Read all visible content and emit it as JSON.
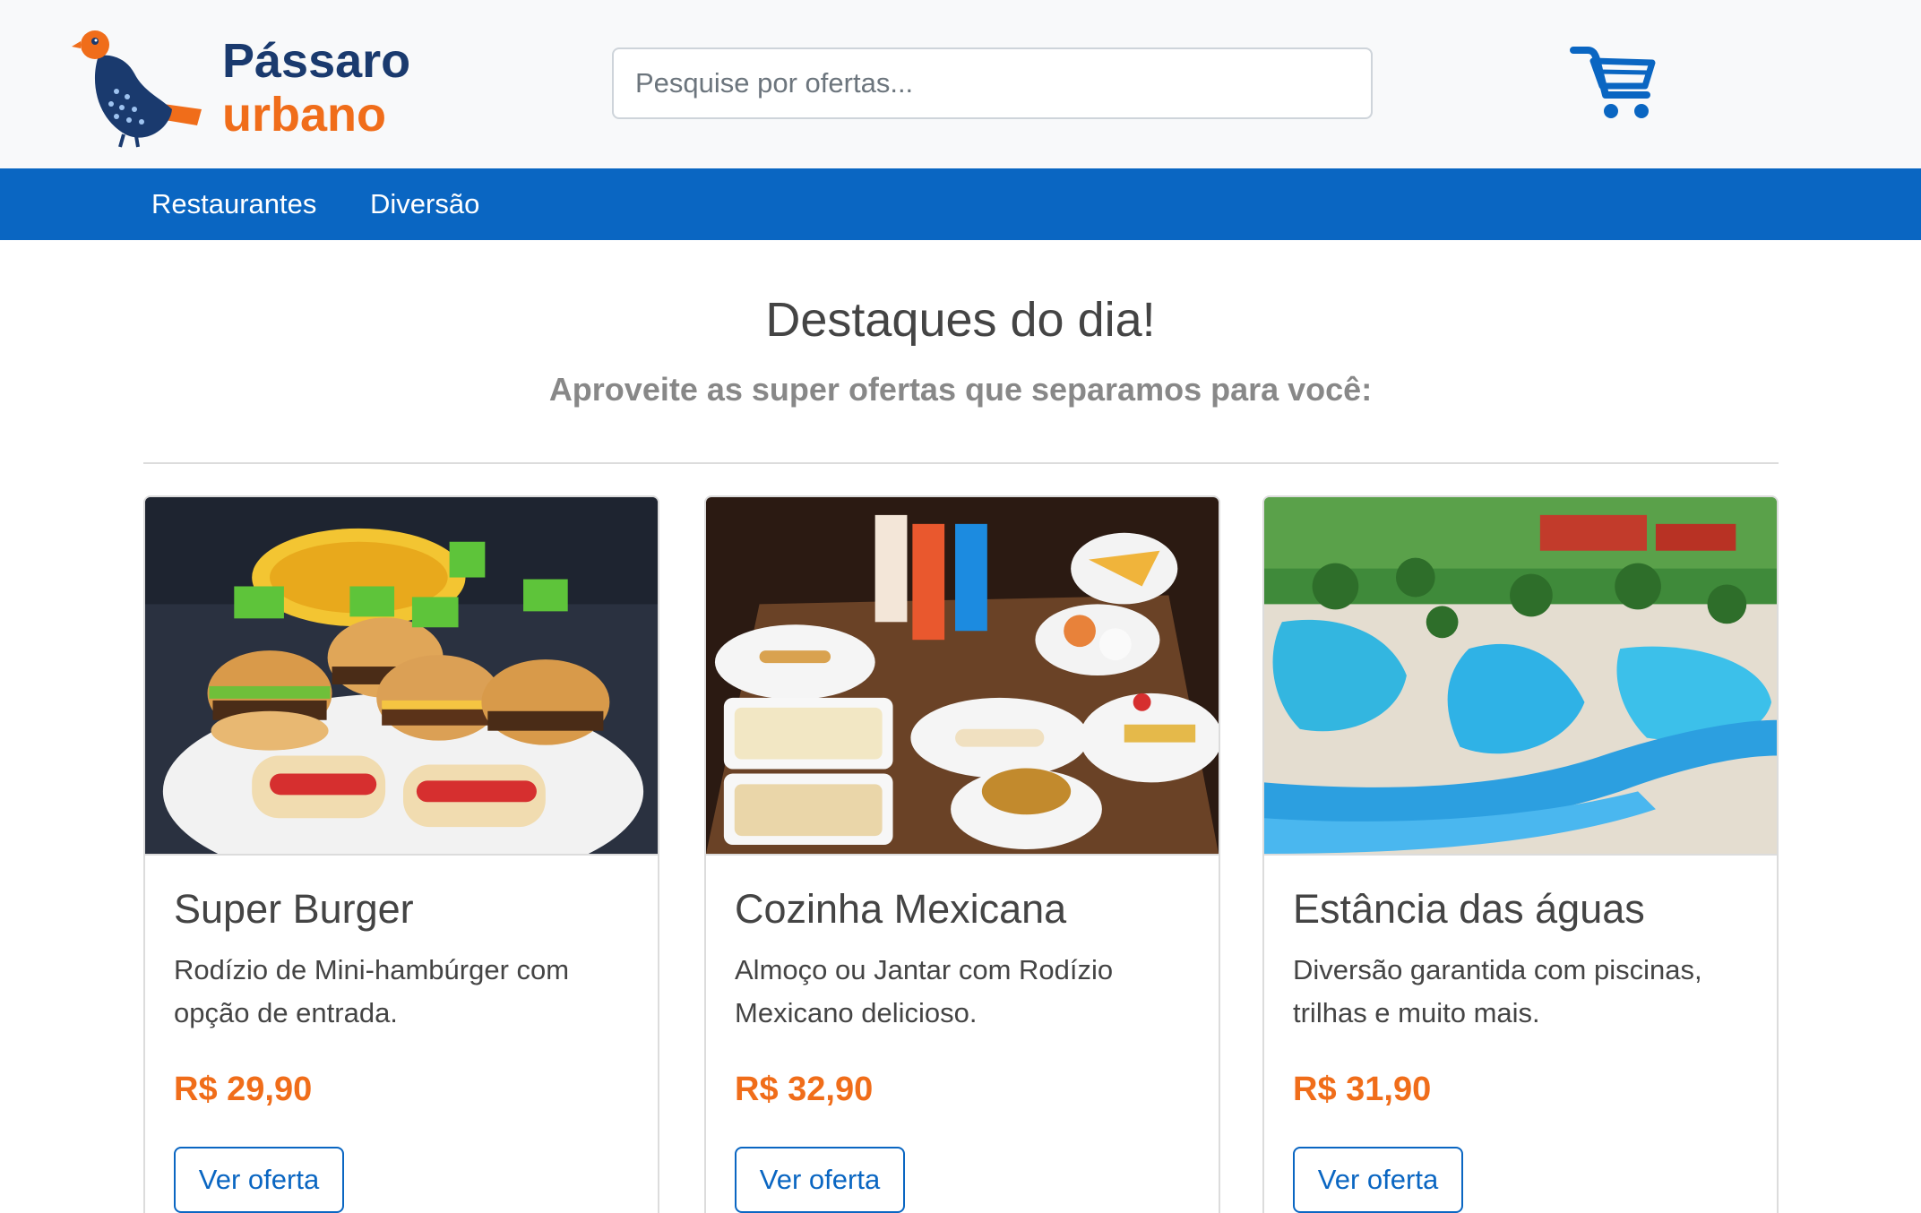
{
  "brand": {
    "line1": "Pássaro",
    "line2": "urbano"
  },
  "search": {
    "placeholder": "Pesquise por ofertas..."
  },
  "nav": [
    {
      "label": "Restaurantes"
    },
    {
      "label": "Diversão"
    }
  ],
  "hero": {
    "title": "Destaques do dia!",
    "subtitle": "Aproveite as super ofertas que separamos para você:"
  },
  "offers": [
    {
      "title": "Super Burger",
      "description": "Rodízio de Mini-hambúrger com opção de entrada.",
      "price": "R$ 29,90",
      "button": "Ver oferta",
      "image_icon": "burger-photo"
    },
    {
      "title": "Cozinha Mexicana",
      "description": "Almoço ou Jantar com Rodízio Mexicano delicioso.",
      "price": "R$ 32,90",
      "button": "Ver oferta",
      "image_icon": "mexican-food-photo"
    },
    {
      "title": "Estância das águas",
      "description": "Diversão garantida com piscinas, trilhas e muito mais.",
      "price": "R$ 31,90",
      "button": "Ver oferta",
      "image_icon": "water-park-photo"
    }
  ],
  "colors": {
    "header_bg": "#f8f9fa",
    "nav_bg": "#0a66c2",
    "accent": "#f06d1a",
    "brand_dark": "#1a3a6e",
    "link": "#0a66c2"
  }
}
